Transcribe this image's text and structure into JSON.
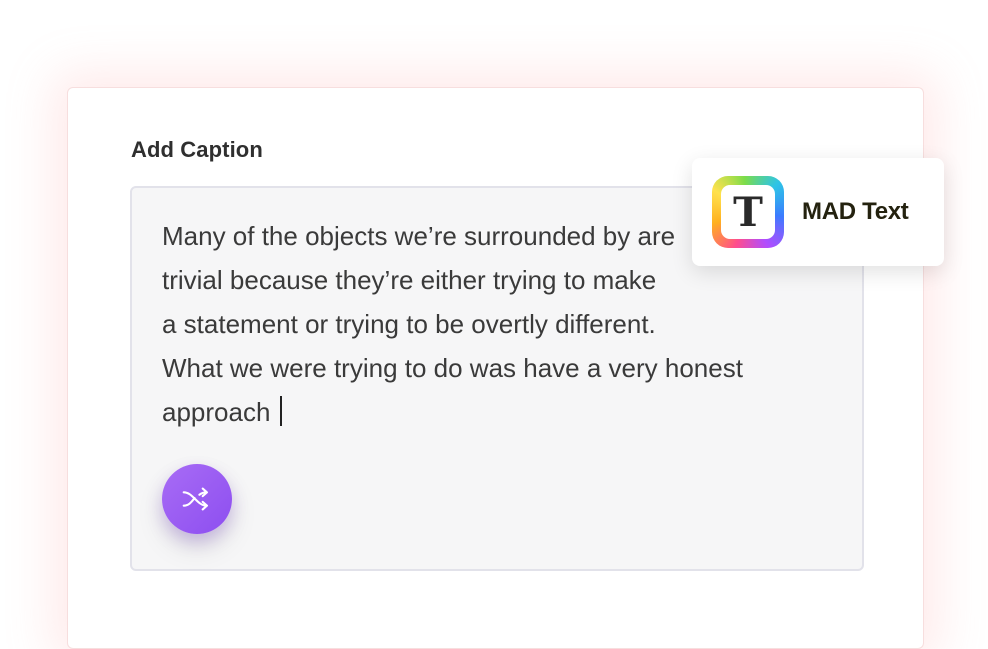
{
  "caption": {
    "label": "Add Caption",
    "text": "Many of the objects we’re surrounded by are\ntrivial because they’re either trying to make\na statement or trying to be overtly different.\nWhat we were trying to do was have a very honest\napproach "
  },
  "shuffle_button": {
    "icon": "shuffle-icon"
  },
  "app_badge": {
    "icon_letter": "T",
    "name": "MAD Text"
  },
  "colors": {
    "accent_purple": "#9b5cf4",
    "textarea_bg": "#f6f6f7",
    "card_glow": "#ffd9d9"
  }
}
